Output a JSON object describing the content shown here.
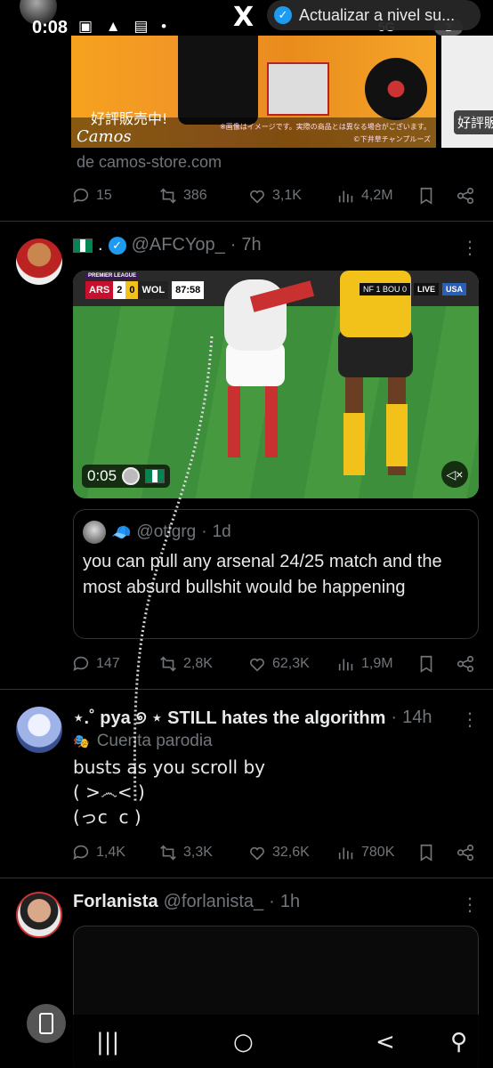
{
  "status_bar": {
    "time": "0:08",
    "icons": "▣ ▲ ▤ •",
    "net": "5G",
    "battery": "2"
  },
  "header": {
    "logo": "X",
    "upgrade_label": "Actualizar a nivel su..."
  },
  "tweet1": {
    "card_caption": "好評販売中!",
    "card_brand": "Camos",
    "card_note": "※画像はイメージです。実際の商品とは異なる場合がございます。",
    "card_copyright": "©下井草チャンプルーズ",
    "card2_caption": "好評販",
    "source": "de camos-store.com",
    "actions": {
      "replies": "15",
      "reposts": "386",
      "likes": "3,1K",
      "views": "4,2M"
    }
  },
  "tweet2": {
    "name_sep": ".",
    "handle": "@AFCYop_",
    "time": "7h",
    "video": {
      "league": "PREMIER LEAGUE",
      "home": "ARS",
      "home_score": "2",
      "away_score": "0",
      "away": "WOL",
      "clock": "87:58",
      "side_score": "NF 1 BOU 0",
      "live": "LIVE",
      "network": "USA",
      "duration": "0:05"
    },
    "quote": {
      "handle": "@otlgrg",
      "time": "1d",
      "text": "you can pull any arsenal 24/25 match and the most absurd bullshit would be happening"
    },
    "actions": {
      "replies": "147",
      "reposts": "2,8K",
      "likes": "62,3K",
      "views": "1,9M"
    }
  },
  "tweet3": {
    "name": "⋆.˚ pya ୭ ⋆ STILL hates the algorithm",
    "time": "14h",
    "parody_label": "Cuenta parodia",
    "text": "busts as you scroll by\n( >෴< )\n(っc  c )",
    "actions": {
      "replies": "1,4K",
      "reposts": "3,3K",
      "likes": "32,6K",
      "views": "780K"
    }
  },
  "tweet4": {
    "name": "Forlanista",
    "handle": "@forlanista_",
    "time": "1h"
  },
  "nav": {
    "recent": "|||",
    "home": "○",
    "back": "<",
    "accessibility": "⚲"
  }
}
